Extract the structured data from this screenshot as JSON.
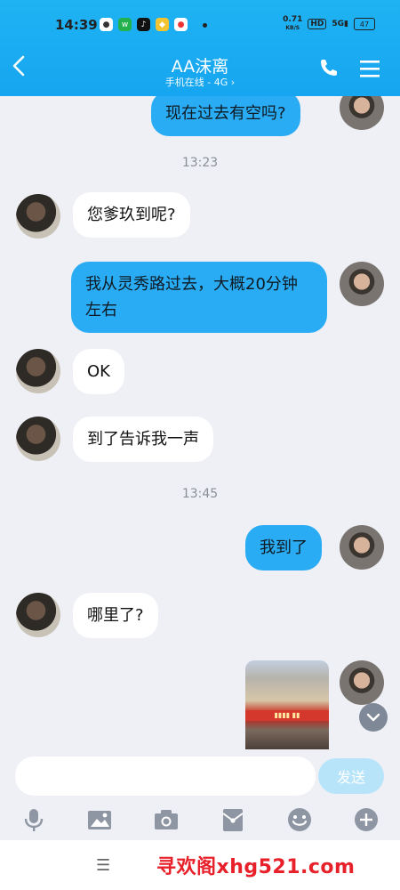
{
  "status_bar": {
    "time": "14:39",
    "speed_top": "0.71",
    "speed_unit": "KB/S",
    "hd": "HD",
    "signal": "5G",
    "battery": "47",
    "apps": [
      "soul-icon",
      "wechat-icon",
      "tiktok-icon",
      "shield-icon",
      "map-icon"
    ]
  },
  "header": {
    "back_label": "‹",
    "title": "AA沫离",
    "subtitle": "手机在线 - 4G ›"
  },
  "messages": [
    {
      "from": "self",
      "text": "现在过去有空吗?"
    },
    {
      "timestamp": "13:23"
    },
    {
      "from": "other",
      "text": "您爹玖到呢?"
    },
    {
      "from": "self",
      "text": "我从灵秀路过去，大概20分钟左右"
    },
    {
      "from": "other",
      "text": "OK"
    },
    {
      "from": "other",
      "text": "到了告诉我一声"
    },
    {
      "timestamp": "13:45"
    },
    {
      "from": "self",
      "text": "我到了"
    },
    {
      "from": "other",
      "text": "哪里了?"
    },
    {
      "from": "self",
      "image": "storefront-photo"
    }
  ],
  "input": {
    "placeholder": "",
    "send_label": "发送"
  },
  "toolbar": [
    "microphone-icon",
    "image-icon",
    "camera-icon",
    "red-packet-icon",
    "emoji-icon",
    "plus-icon"
  ],
  "nav": {
    "menu_label": "☰",
    "watermark": "寻欢阁xhg521.com"
  },
  "colors": {
    "header": "#1FB3F3",
    "self_bubble": "#2AACF4",
    "background": "#EEF0F6",
    "send_button": "#B8E4FA",
    "watermark": "#E8202A"
  }
}
